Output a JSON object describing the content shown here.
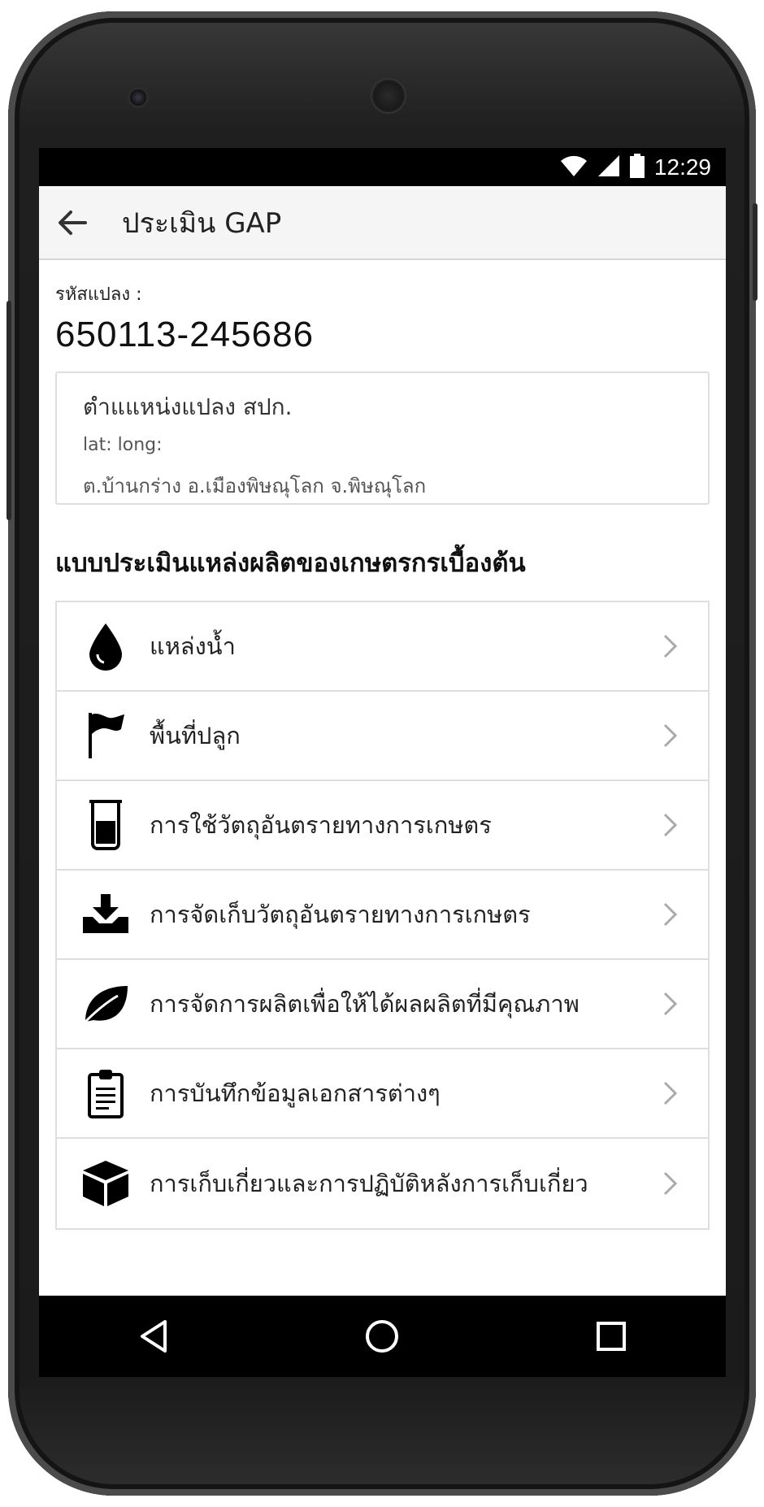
{
  "status_bar": {
    "time": "12:29",
    "icons": [
      "wifi-icon",
      "signal-icon",
      "battery-icon"
    ]
  },
  "app_bar": {
    "title": "ประเมิน GAP",
    "back_icon": "arrow-back-icon"
  },
  "plot": {
    "label": "รหัสแปลง :",
    "code": "650113-245686"
  },
  "location": {
    "title": "ตำแแหน่งแปลง สปก.",
    "latlong": "lat: long:",
    "address": "ต.บ้านกร่าง อ.เมืองพิษณุโลก จ.พิษณุโลก"
  },
  "section_title": "แบบประเมินแหล่งผลิตของเกษตรกรเบื้องต้น",
  "items": [
    {
      "label": "แหล่งน้ำ",
      "icon": "water-drop-icon"
    },
    {
      "label": "พื้นที่ปลูก",
      "icon": "flag-icon"
    },
    {
      "label": "การใช้วัตถุอันตรายทางการเกษตร",
      "icon": "beaker-icon"
    },
    {
      "label": "การจัดเก็บวัตถุอันตรายทางการเกษตร",
      "icon": "inbox-download-icon"
    },
    {
      "label": "การจัดการผลิตเพื่อให้ได้ผลผลิตที่มีคุณภาพ",
      "icon": "leaf-icon"
    },
    {
      "label": "การบันทึกข้อมูลเอกสารต่างๆ",
      "icon": "clipboard-icon"
    },
    {
      "label": "การเก็บเกี่ยวและการปฏิบัติหลังการเก็บเกี่ยว",
      "icon": "box-icon"
    }
  ],
  "colors": {
    "app_bar_bg": "#f5f5f5",
    "status_bar_bg": "#000000",
    "text": "#222222",
    "divider": "#dedede"
  }
}
